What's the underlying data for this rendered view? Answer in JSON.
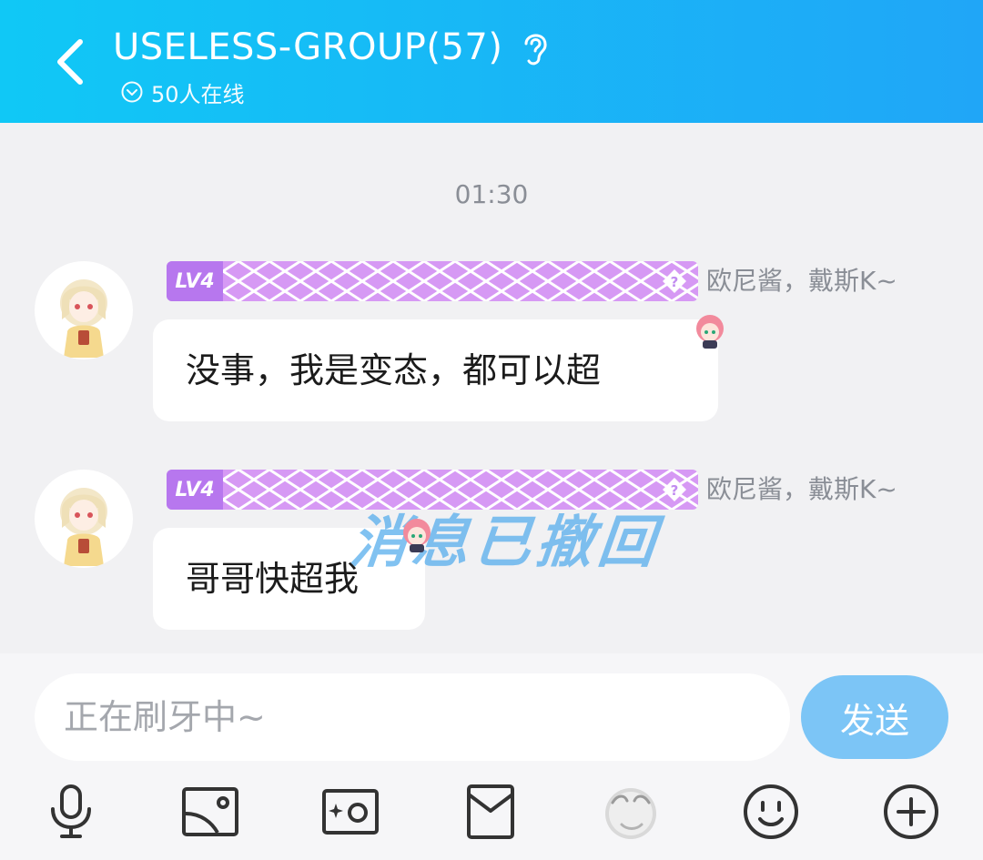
{
  "header": {
    "title": "USELESS-GROUP(57)",
    "online": "50人在线"
  },
  "chat": {
    "time": "01:30",
    "messages": [
      {
        "level": "LV4",
        "nickname": "欧尼酱，戴斯K~",
        "text": "没事，我是变态，都可以超"
      },
      {
        "level": "LV4",
        "nickname": "欧尼酱，戴斯K~",
        "text": "哥哥快超我"
      }
    ],
    "watermark": "消息已撤回"
  },
  "input": {
    "placeholder": "正在刷牙中~",
    "send_label": "发送"
  },
  "toolbar": {
    "icons": [
      "microphone-icon",
      "image-icon",
      "camera-icon",
      "red-packet-icon",
      "sticker-icon",
      "emoji-icon",
      "plus-icon"
    ]
  },
  "colors": {
    "header_start": "#10c8f6",
    "header_end": "#20a6f7",
    "badge": "#d699f4",
    "send": "#7cc5f6"
  }
}
